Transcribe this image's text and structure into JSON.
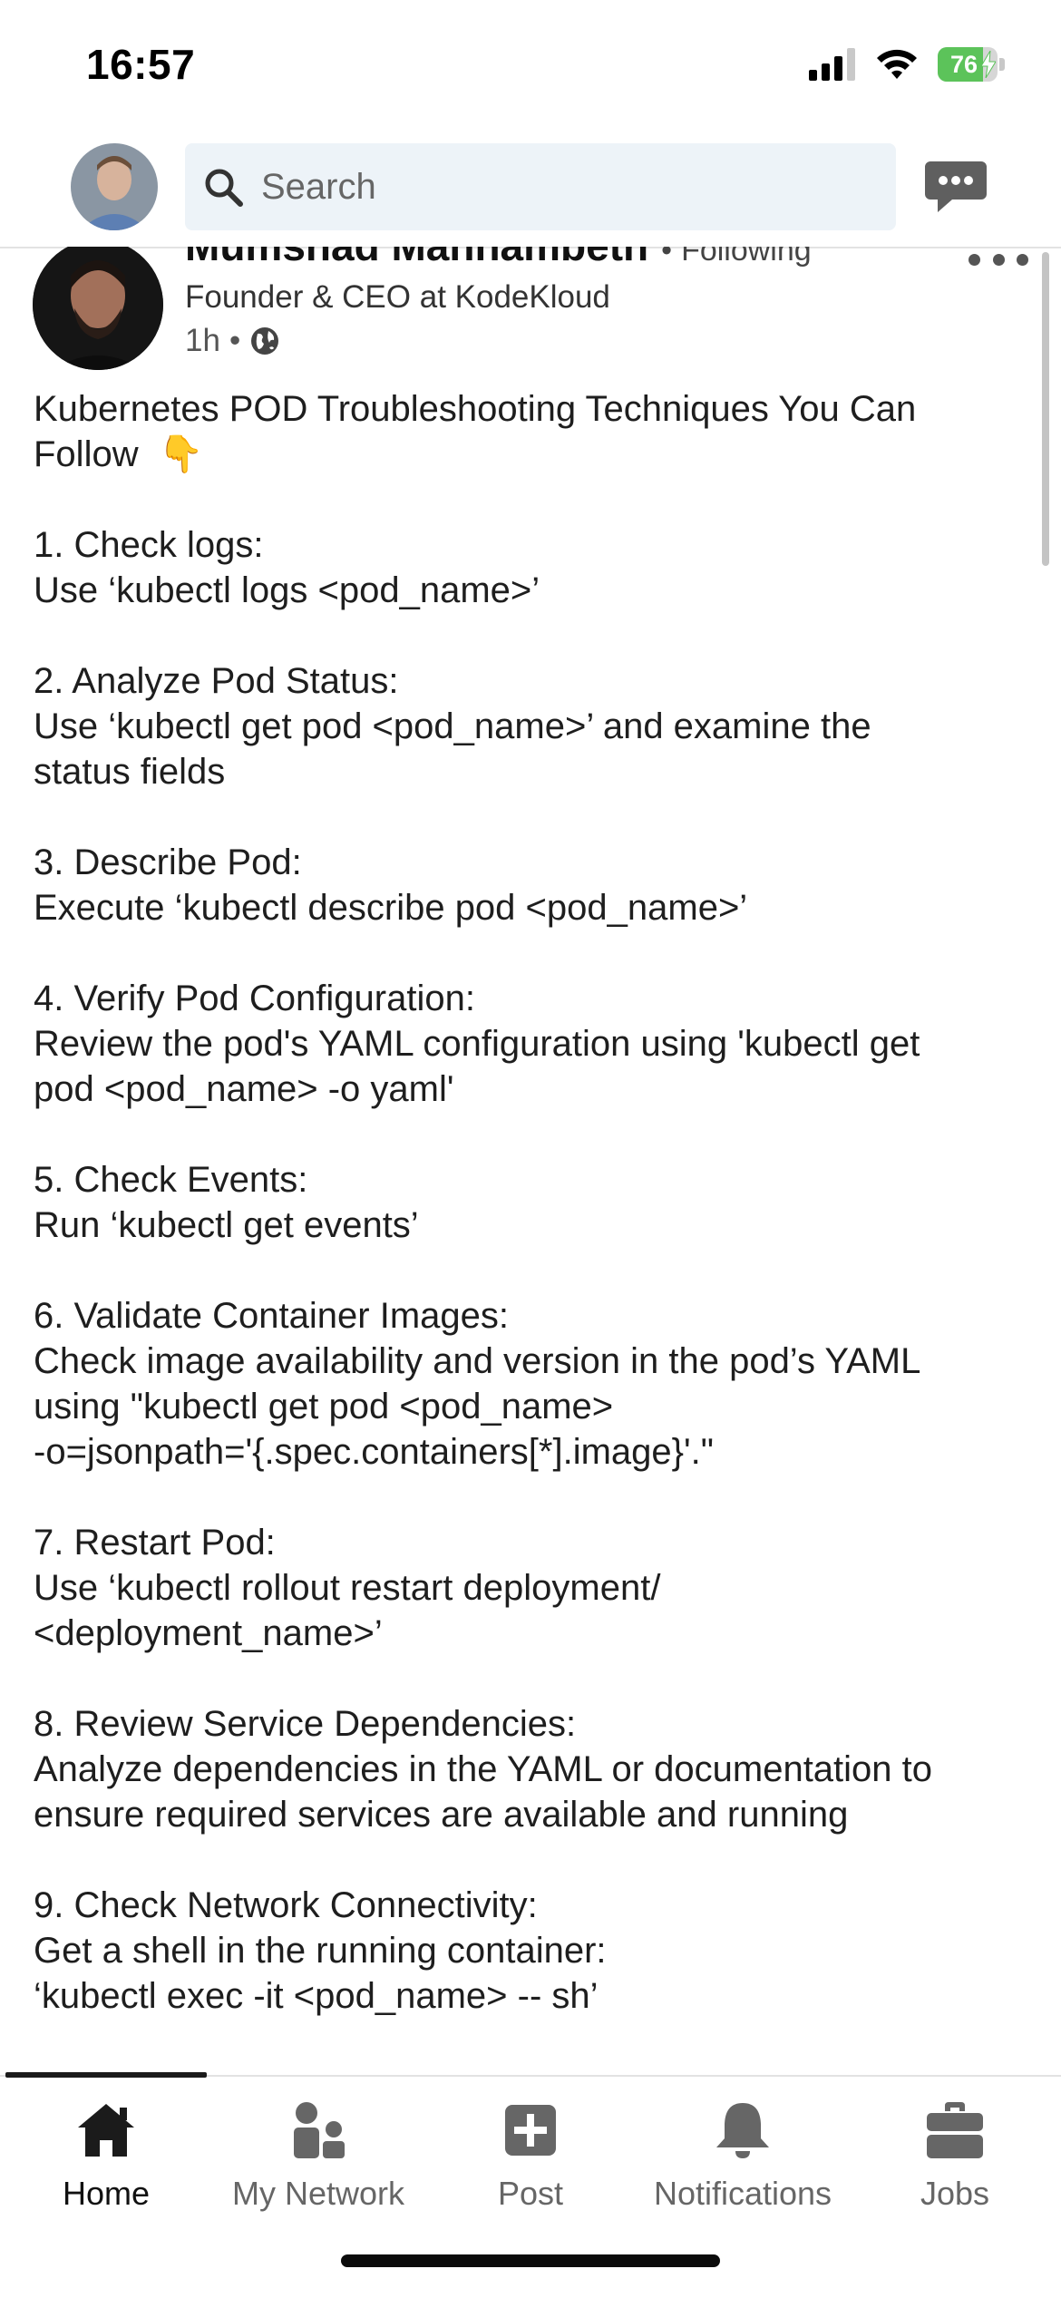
{
  "status_bar": {
    "time": "16:57",
    "battery_percent": "76",
    "icons": [
      "signal-icon",
      "wifi-icon",
      "battery-charging-icon"
    ]
  },
  "header": {
    "search_placeholder": "Search",
    "icons": [
      "search-icon",
      "messaging-icon"
    ]
  },
  "post": {
    "author_name": "Mumshad Mannambeth",
    "separator": "•",
    "following_label": "Following",
    "headline": "Founder & CEO at KodeKloud",
    "time_ago": "1h",
    "meta_separator": "•",
    "body": {
      "title_line1": "Kubernetes POD Troubleshooting Techniques You Can",
      "title_line2": "Follow",
      "emoji": "👇",
      "lines": [
        "",
        "1. Check logs:",
        "Use ‘kubectl logs <pod_name>’",
        "",
        "2. Analyze Pod Status:",
        "Use ‘kubectl get pod <pod_name>’ and examine the",
        "status fields",
        "",
        "3. Describe Pod:",
        "Execute ‘kubectl describe pod <pod_name>’",
        "",
        "4. Verify Pod Configuration:",
        "Review the pod's YAML configuration using 'kubectl get",
        "pod <pod_name> -o yaml'",
        "",
        "5. Check Events:",
        "Run ‘kubectl get events’",
        "",
        "6. Validate Container Images:",
        "Check image availability and version in the pod’s YAML",
        "using \"kubectl get pod <pod_name>",
        "-o=jsonpath='{.spec.containers[*].image}'.\"",
        "",
        "7. Restart Pod:",
        "Use ‘kubectl rollout restart deployment/",
        "<deployment_name>’",
        "",
        "8. Review Service Dependencies:",
        "Analyze dependencies in the YAML or documentation to",
        "ensure required services are available and running",
        "",
        "9. Check Network Connectivity:",
        "Get a shell in the running container:",
        "‘kubectl exec -it <pod_name> -- sh’"
      ]
    }
  },
  "tabs": [
    {
      "label": "Home",
      "icon": "home-icon",
      "active": true
    },
    {
      "label": "My Network",
      "icon": "my-network-icon",
      "active": false
    },
    {
      "label": "Post",
      "icon": "post-icon",
      "active": false
    },
    {
      "label": "Notifications",
      "icon": "notifications-icon",
      "active": false
    },
    {
      "label": "Jobs",
      "icon": "jobs-icon",
      "active": false
    }
  ],
  "colors": {
    "battery_green": "#5cc35a",
    "search_bg": "#edf3f8",
    "icon_gray": "#666666",
    "active_tab": "#111111"
  }
}
